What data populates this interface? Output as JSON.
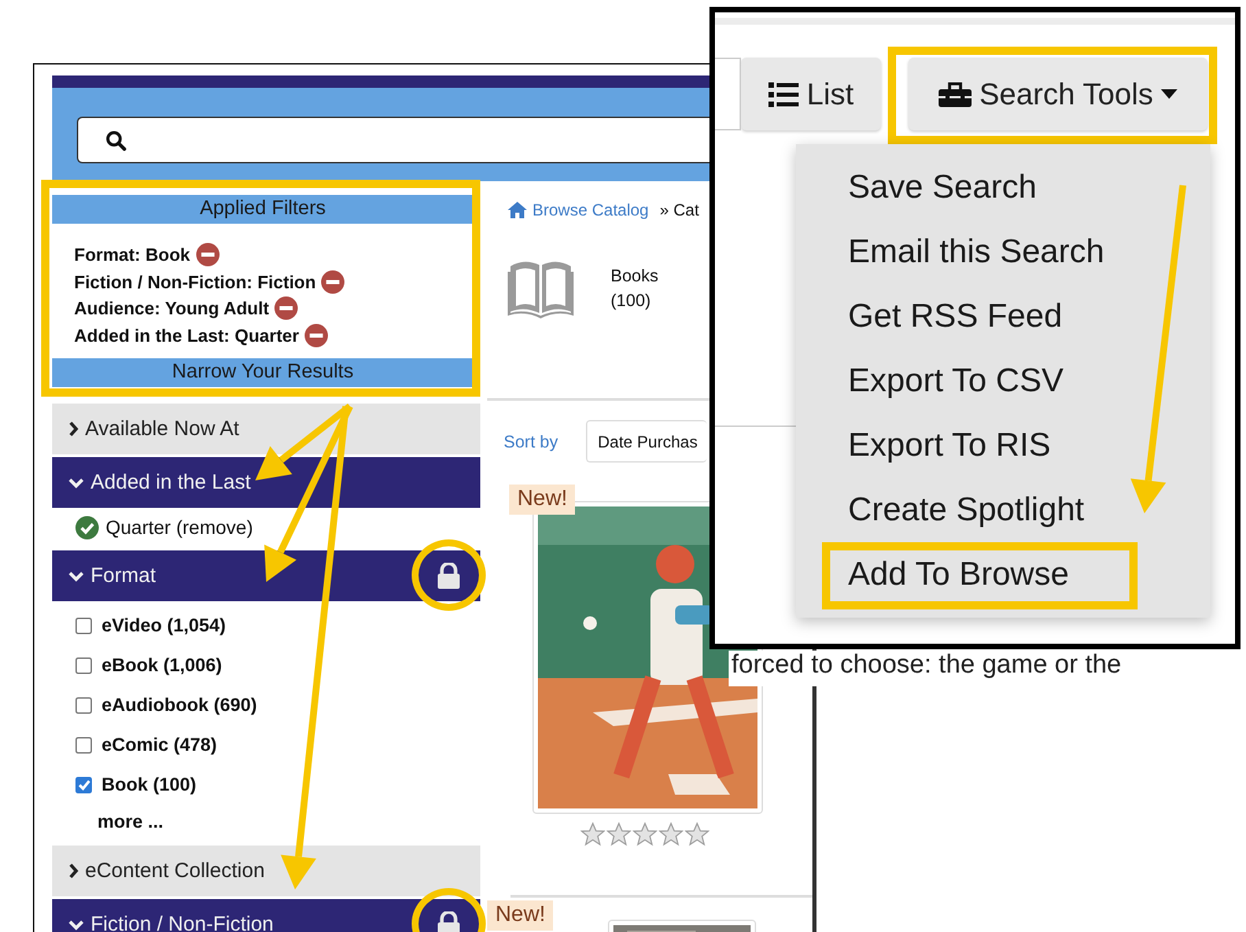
{
  "applied_filters": {
    "title": "Applied Filters",
    "highlighted": true,
    "filters": [
      {
        "label": "Format: Book"
      },
      {
        "label": "Fiction / Non-Fiction: Fiction"
      },
      {
        "label": "Audience: Young Adult"
      },
      {
        "label": "Added in the Last: Quarter"
      }
    ]
  },
  "narrow_title": "Narrow Your Results",
  "facets": [
    {
      "label": "Available Now At",
      "expanded": false,
      "locked": false
    },
    {
      "label": "Added in the Last",
      "expanded": true,
      "locked": false,
      "values": [
        {
          "kind": "applied",
          "label": "Quarter (remove)"
        }
      ]
    },
    {
      "label": "Format",
      "expanded": true,
      "locked": true,
      "values": [
        {
          "kind": "checkbox",
          "label": "eVideo (1,054)",
          "checked": false
        },
        {
          "kind": "checkbox",
          "label": "eBook (1,006)",
          "checked": false
        },
        {
          "kind": "checkbox",
          "label": "eAudiobook (690)",
          "checked": false
        },
        {
          "kind": "checkbox",
          "label": "eComic (478)",
          "checked": false
        },
        {
          "kind": "checkbox",
          "label": "Book (100)",
          "checked": true
        }
      ],
      "more": "more ..."
    },
    {
      "label": "eContent Collection",
      "expanded": false,
      "locked": false
    },
    {
      "label": "Fiction / Non-Fiction",
      "expanded": true,
      "locked": true
    }
  ],
  "breadcrumb": {
    "link": "Browse Catalog",
    "rest": "» Cat"
  },
  "category": {
    "label": "Books",
    "count": "(100)"
  },
  "sort": {
    "label": "Sort by",
    "value": "Date Purchas"
  },
  "results": [
    {
      "badge": "New!",
      "kind": "picture",
      "stars": 0
    },
    {
      "badge": "New!",
      "kind": "picture"
    }
  ],
  "snippet": "forced to choose: the game or the",
  "inset": {
    "view_button": "List",
    "tools_button": {
      "label": "Search Tools",
      "highlighted": true
    },
    "menu": [
      {
        "label": "Save Search",
        "highlighted": false
      },
      {
        "label": "Email this Search",
        "highlighted": false
      },
      {
        "label": "Get RSS Feed",
        "highlighted": false
      },
      {
        "label": "Export To CSV",
        "highlighted": false
      },
      {
        "label": "Export To RIS",
        "highlighted": false
      },
      {
        "label": "Create Spotlight",
        "highlighted": false
      },
      {
        "label": "Add To Browse",
        "highlighted": true
      }
    ]
  }
}
